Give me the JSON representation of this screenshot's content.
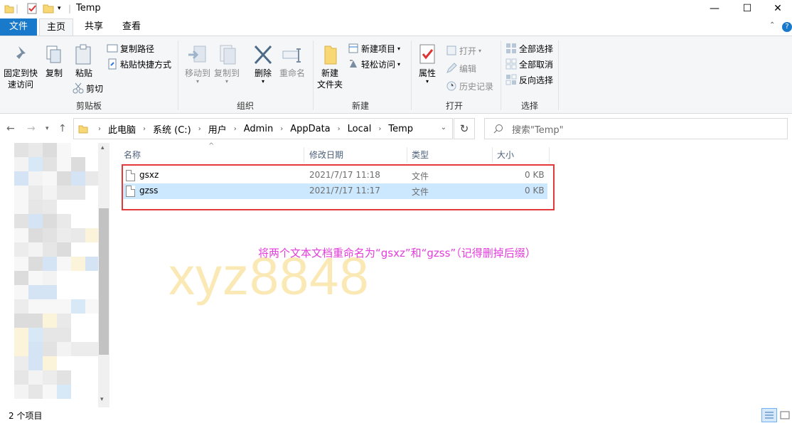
{
  "window": {
    "title": "Temp",
    "minimize": "—",
    "maximize": "☐",
    "close": "✕"
  },
  "tabs": {
    "file": "文件",
    "home": "主页",
    "share": "共享",
    "view": "查看"
  },
  "ribbon": {
    "clipboard": {
      "label": "剪贴板",
      "pin": "固定到快\n速访问",
      "pin_l1": "固定到快",
      "pin_l2": "速访问",
      "copy": "复制",
      "paste": "粘贴",
      "copy_path": "复制路径",
      "paste_shortcut": "粘贴快捷方式",
      "cut": "剪切"
    },
    "organize": {
      "label": "组织",
      "move_to": "移动到",
      "copy_to": "复制到",
      "delete": "删除",
      "rename": "重命名"
    },
    "new": {
      "label": "新建",
      "new_folder_l1": "新建",
      "new_folder_l2": "文件夹",
      "new_item": "新建项目",
      "easy_access": "轻松访问"
    },
    "open": {
      "label": "打开",
      "properties": "属性",
      "open": "打开",
      "edit": "编辑",
      "history": "历史记录"
    },
    "select": {
      "label": "选择",
      "select_all": "全部选择",
      "select_none": "全部取消",
      "invert": "反向选择"
    }
  },
  "address": {
    "crumbs": [
      "此电脑",
      "系统 (C:)",
      "用户",
      "Admin",
      "AppData",
      "Local",
      "Temp"
    ],
    "search_placeholder": "搜索\"Temp\""
  },
  "columns": {
    "name": "名称",
    "modified": "修改日期",
    "type": "类型",
    "size": "大小"
  },
  "files": [
    {
      "name": "gsxz",
      "modified": "2021/7/17 11:18",
      "type": "文件",
      "size": "0 KB"
    },
    {
      "name": "gzss",
      "modified": "2021/7/17 11:17",
      "type": "文件",
      "size": "0 KB"
    }
  ],
  "annotation": "将两个文本文档重命名为“gsxz”和“gzss”（记得删掉后缀）",
  "watermark": "xyz8848",
  "status": {
    "count": "2 个项目"
  },
  "colors": {
    "file_tab": "#1979ca",
    "selection": "#cce8ff",
    "highlight_box": "#e23a3a",
    "annotation": "#e53cdc",
    "watermark": "#fbe9b5"
  }
}
